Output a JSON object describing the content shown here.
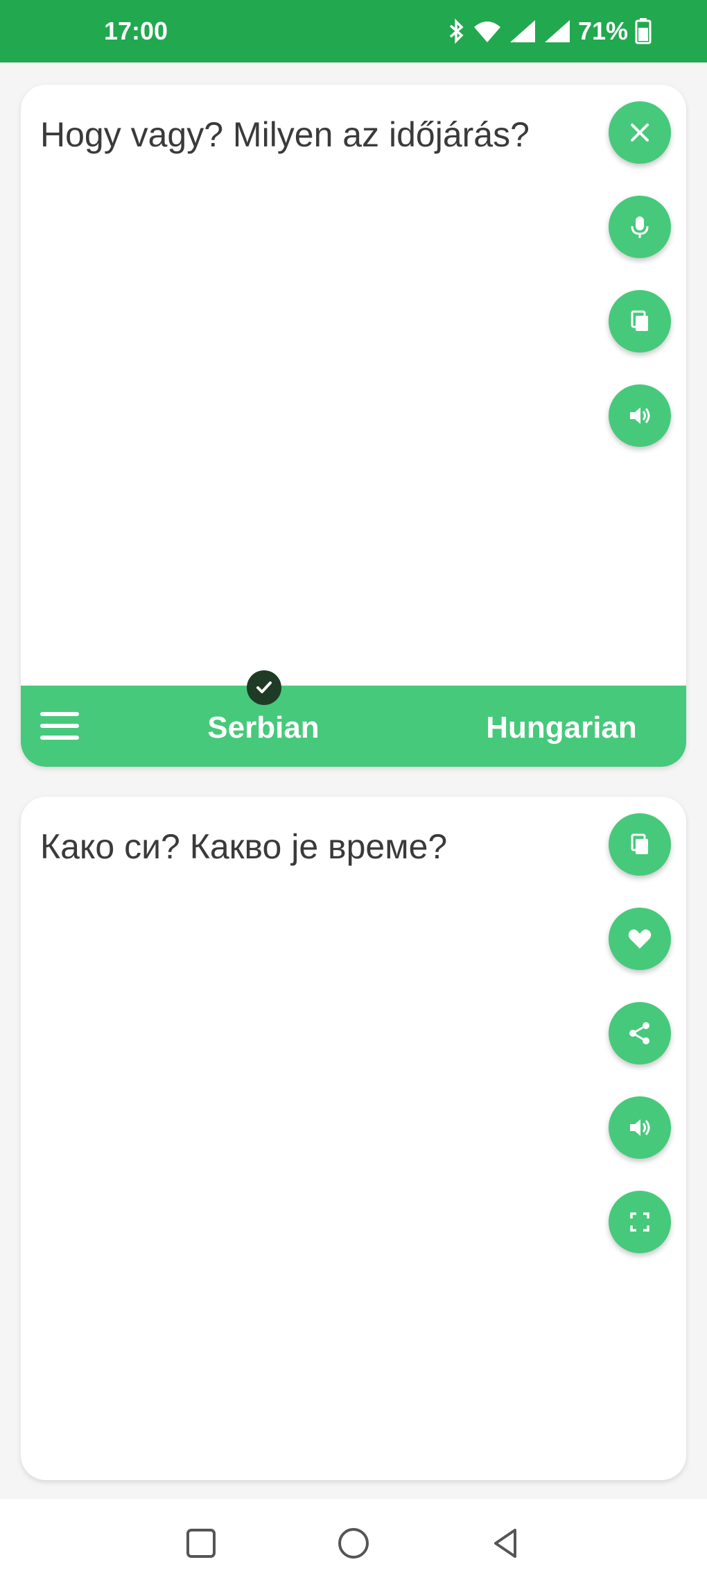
{
  "status_bar": {
    "time": "17:00",
    "battery": "71%",
    "icons": [
      "bluetooth-icon",
      "wifi-icon",
      "signal-icon",
      "signal-icon",
      "battery-icon"
    ]
  },
  "input_card": {
    "text": "Hogy vagy? Milyen az időjárás?",
    "actions": [
      "clear-icon",
      "microphone-icon",
      "copy-icon",
      "speaker-icon"
    ]
  },
  "language_bar": {
    "source": "Serbian",
    "target": "Hungarian",
    "menu_icon": "menu-icon",
    "check_icon": "check-icon"
  },
  "output_card": {
    "text": "Како си? Какво је време?",
    "actions": [
      "copy-icon",
      "heart-icon",
      "share-icon",
      "speaker-icon",
      "fullscreen-icon"
    ]
  },
  "navigation": [
    "recents-icon",
    "home-icon",
    "back-icon"
  ],
  "colors": {
    "status_bar": "#22a84f",
    "accent": "#46c97b",
    "check_badge": "#1f3b25"
  }
}
